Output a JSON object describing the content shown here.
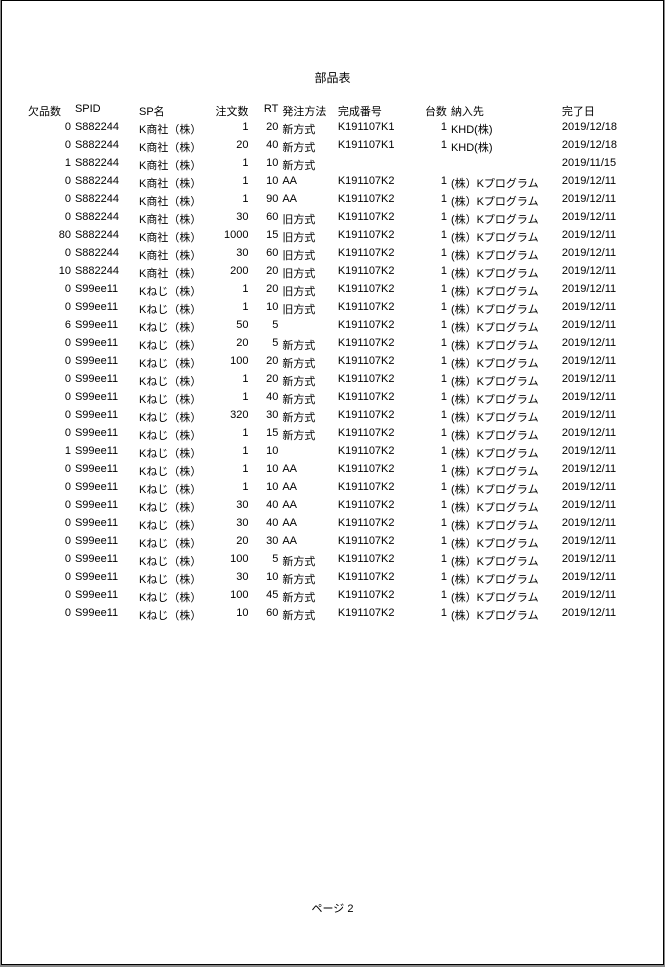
{
  "title": "部品表",
  "footer": "ページ 2",
  "headers": {
    "qty": "欠品数",
    "spid": "SPID",
    "spname": "SP名",
    "order": "注文数",
    "rt": "RT",
    "method": "発注方法",
    "comp": "完成番号",
    "units": "台数",
    "dest": "納入先",
    "date": "完了日"
  },
  "rows": [
    {
      "qty": "0",
      "spid": "S882244",
      "spname": "K商社（株）",
      "order": "1",
      "rt": "20",
      "method": "新方式",
      "comp": "K191107K1",
      "units": "1",
      "dest": "KHD(株)",
      "date": "2019/12/18"
    },
    {
      "qty": "0",
      "spid": "S882244",
      "spname": "K商社（株）",
      "order": "20",
      "rt": "40",
      "method": "新方式",
      "comp": "K191107K1",
      "units": "1",
      "dest": "KHD(株)",
      "date": "2019/12/18"
    },
    {
      "qty": "1",
      "spid": "S882244",
      "spname": "K商社（株）",
      "order": "1",
      "rt": "10",
      "method": "新方式",
      "comp": "",
      "units": "",
      "dest": "",
      "date": "2019/11/15"
    },
    {
      "qty": "0",
      "spid": "S882244",
      "spname": "K商社（株）",
      "order": "1",
      "rt": "10",
      "method": "AA",
      "comp": "K191107K2",
      "units": "1",
      "dest": "(株）Kプログラム",
      "date": "2019/12/11"
    },
    {
      "qty": "0",
      "spid": "S882244",
      "spname": "K商社（株）",
      "order": "1",
      "rt": "90",
      "method": "AA",
      "comp": "K191107K2",
      "units": "1",
      "dest": "(株）Kプログラム",
      "date": "2019/12/11"
    },
    {
      "qty": "0",
      "spid": "S882244",
      "spname": "K商社（株）",
      "order": "30",
      "rt": "60",
      "method": "旧方式",
      "comp": "K191107K2",
      "units": "1",
      "dest": "(株）Kプログラム",
      "date": "2019/12/11"
    },
    {
      "qty": "80",
      "spid": "S882244",
      "spname": "K商社（株）",
      "order": "1000",
      "rt": "15",
      "method": "旧方式",
      "comp": "K191107K2",
      "units": "1",
      "dest": "(株）Kプログラム",
      "date": "2019/12/11"
    },
    {
      "qty": "0",
      "spid": "S882244",
      "spname": "K商社（株）",
      "order": "30",
      "rt": "60",
      "method": "旧方式",
      "comp": "K191107K2",
      "units": "1",
      "dest": "(株）Kプログラム",
      "date": "2019/12/11"
    },
    {
      "qty": "10",
      "spid": "S882244",
      "spname": "K商社（株）",
      "order": "200",
      "rt": "20",
      "method": "旧方式",
      "comp": "K191107K2",
      "units": "1",
      "dest": "(株）Kプログラム",
      "date": "2019/12/11"
    },
    {
      "qty": "0",
      "spid": "S99ee11",
      "spname": "Kねじ（株）",
      "order": "1",
      "rt": "20",
      "method": "旧方式",
      "comp": "K191107K2",
      "units": "1",
      "dest": "(株）Kプログラム",
      "date": "2019/12/11"
    },
    {
      "qty": "0",
      "spid": "S99ee11",
      "spname": "Kねじ（株）",
      "order": "1",
      "rt": "10",
      "method": "旧方式",
      "comp": "K191107K2",
      "units": "1",
      "dest": "(株）Kプログラム",
      "date": "2019/12/11"
    },
    {
      "qty": "6",
      "spid": "S99ee11",
      "spname": "Kねじ（株）",
      "order": "50",
      "rt": "5",
      "method": "",
      "comp": "K191107K2",
      "units": "1",
      "dest": "(株）Kプログラム",
      "date": "2019/12/11"
    },
    {
      "qty": "0",
      "spid": "S99ee11",
      "spname": "Kねじ（株）",
      "order": "20",
      "rt": "5",
      "method": "新方式",
      "comp": "K191107K2",
      "units": "1",
      "dest": "(株）Kプログラム",
      "date": "2019/12/11"
    },
    {
      "qty": "0",
      "spid": "S99ee11",
      "spname": "Kねじ（株）",
      "order": "100",
      "rt": "20",
      "method": "新方式",
      "comp": "K191107K2",
      "units": "1",
      "dest": "(株）Kプログラム",
      "date": "2019/12/11"
    },
    {
      "qty": "0",
      "spid": "S99ee11",
      "spname": "Kねじ（株）",
      "order": "1",
      "rt": "20",
      "method": "新方式",
      "comp": "K191107K2",
      "units": "1",
      "dest": "(株）Kプログラム",
      "date": "2019/12/11"
    },
    {
      "qty": "0",
      "spid": "S99ee11",
      "spname": "Kねじ（株）",
      "order": "1",
      "rt": "40",
      "method": "新方式",
      "comp": "K191107K2",
      "units": "1",
      "dest": "(株）Kプログラム",
      "date": "2019/12/11"
    },
    {
      "qty": "0",
      "spid": "S99ee11",
      "spname": "Kねじ（株）",
      "order": "320",
      "rt": "30",
      "method": "新方式",
      "comp": "K191107K2",
      "units": "1",
      "dest": "(株）Kプログラム",
      "date": "2019/12/11"
    },
    {
      "qty": "0",
      "spid": "S99ee11",
      "spname": "Kねじ（株）",
      "order": "1",
      "rt": "15",
      "method": "新方式",
      "comp": "K191107K2",
      "units": "1",
      "dest": "(株）Kプログラム",
      "date": "2019/12/11"
    },
    {
      "qty": "1",
      "spid": "S99ee11",
      "spname": "Kねじ（株）",
      "order": "1",
      "rt": "10",
      "method": "",
      "comp": "K191107K2",
      "units": "1",
      "dest": "(株）Kプログラム",
      "date": "2019/12/11"
    },
    {
      "qty": "0",
      "spid": "S99ee11",
      "spname": "Kねじ（株）",
      "order": "1",
      "rt": "10",
      "method": "AA",
      "comp": "K191107K2",
      "units": "1",
      "dest": "(株）Kプログラム",
      "date": "2019/12/11"
    },
    {
      "qty": "0",
      "spid": "S99ee11",
      "spname": "Kねじ（株）",
      "order": "1",
      "rt": "10",
      "method": "AA",
      "comp": "K191107K2",
      "units": "1",
      "dest": "(株）Kプログラム",
      "date": "2019/12/11"
    },
    {
      "qty": "0",
      "spid": "S99ee11",
      "spname": "Kねじ（株）",
      "order": "30",
      "rt": "40",
      "method": "AA",
      "comp": "K191107K2",
      "units": "1",
      "dest": "(株）Kプログラム",
      "date": "2019/12/11"
    },
    {
      "qty": "0",
      "spid": "S99ee11",
      "spname": "Kねじ（株）",
      "order": "30",
      "rt": "40",
      "method": "AA",
      "comp": "K191107K2",
      "units": "1",
      "dest": "(株）Kプログラム",
      "date": "2019/12/11"
    },
    {
      "qty": "0",
      "spid": "S99ee11",
      "spname": "Kねじ（株）",
      "order": "20",
      "rt": "30",
      "method": "AA",
      "comp": "K191107K2",
      "units": "1",
      "dest": "(株）Kプログラム",
      "date": "2019/12/11"
    },
    {
      "qty": "0",
      "spid": "S99ee11",
      "spname": "Kねじ（株）",
      "order": "100",
      "rt": "5",
      "method": "新方式",
      "comp": "K191107K2",
      "units": "1",
      "dest": "(株）Kプログラム",
      "date": "2019/12/11"
    },
    {
      "qty": "0",
      "spid": "S99ee11",
      "spname": "Kねじ（株）",
      "order": "30",
      "rt": "10",
      "method": "新方式",
      "comp": "K191107K2",
      "units": "1",
      "dest": "(株）Kプログラム",
      "date": "2019/12/11"
    },
    {
      "qty": "0",
      "spid": "S99ee11",
      "spname": "Kねじ（株）",
      "order": "100",
      "rt": "45",
      "method": "新方式",
      "comp": "K191107K2",
      "units": "1",
      "dest": "(株）Kプログラム",
      "date": "2019/12/11"
    },
    {
      "qty": "0",
      "spid": "S99ee11",
      "spname": "Kねじ（株）",
      "order": "10",
      "rt": "60",
      "method": "新方式",
      "comp": "K191107K2",
      "units": "1",
      "dest": "(株）Kプログラム",
      "date": "2019/12/11"
    }
  ]
}
